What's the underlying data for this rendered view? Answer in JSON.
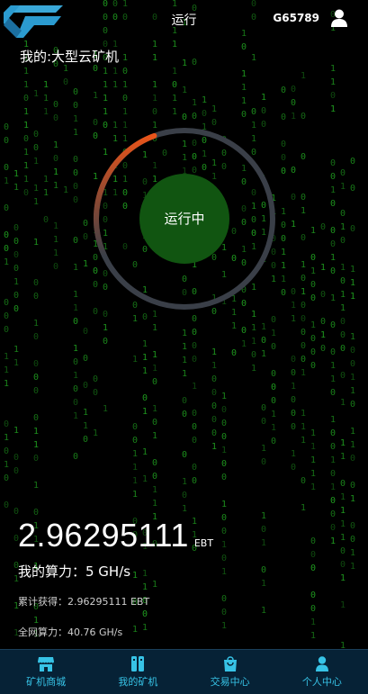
{
  "header": {
    "title": "运行",
    "user_code": "G65789"
  },
  "page_title": "我的:大型云矿机",
  "status": {
    "label": "运行中",
    "progress": 0.12
  },
  "stats": {
    "earnings_value": "2.96295111",
    "earnings_unit": "EBT",
    "hashrate": "我的算力：5 GH/s",
    "total_earned": "累计获得：2.96295111 EBT",
    "network_hashrate": "全网算力：40.76 GH/s"
  },
  "nav": [
    {
      "label": "矿机商城",
      "icon": "shop-icon"
    },
    {
      "label": "我的矿机",
      "icon": "miner-icon"
    },
    {
      "label": "交易中心",
      "icon": "bag-icon"
    },
    {
      "label": "个人中心",
      "icon": "person-icon"
    }
  ],
  "colors": {
    "accent": "#37c3e6",
    "nav_bg": "#062236",
    "status_fill": "#115511",
    "progress_start": "#e8541a",
    "ring_track": "#3a3f48",
    "matrix_digit": "#1f9a1f"
  }
}
